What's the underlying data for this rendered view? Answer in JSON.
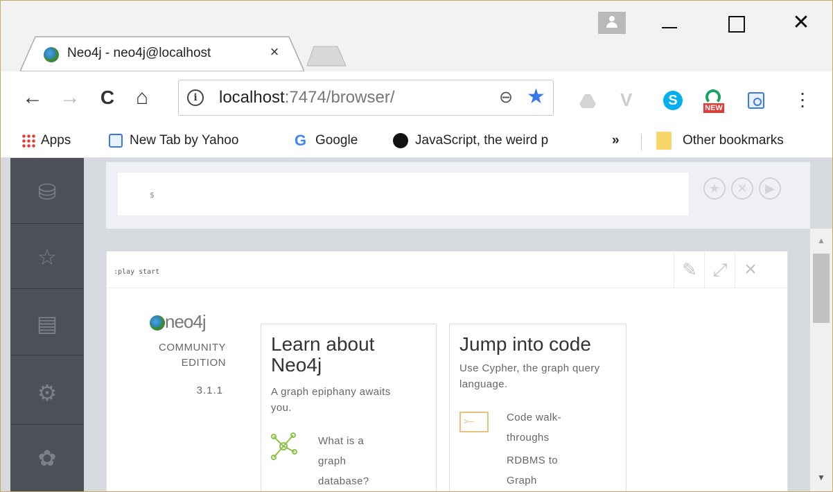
{
  "tab": {
    "title": "Neo4j - neo4j@localhost",
    "close": "×"
  },
  "window": {
    "minimize": "—",
    "maximize": "☐",
    "close": "✕"
  },
  "toolbar": {
    "back": "←",
    "forward": "→",
    "reload": "C",
    "home": "⌂",
    "url_host": "localhost",
    "url_rest": ":7474/browser/",
    "info": "i",
    "zoom": "⊖",
    "star": "★",
    "new_badge": "NEW",
    "skype": "S",
    "menu": "⋮"
  },
  "bookmarks": {
    "apps": "Apps",
    "items": [
      "New Tab by Yahoo",
      "Google",
      "JavaScript, the weird p"
    ],
    "google_glyph": "G",
    "more": "»",
    "other": "Other bookmarks"
  },
  "editor": {
    "prompt": "$"
  },
  "frame": {
    "command": ":play start"
  },
  "brand": {
    "name": "neo4j",
    "edition": "COMMUNITY EDITION",
    "version": "3.1.1"
  },
  "cards": {
    "learn": {
      "title": "Learn about Neo4j",
      "subtitle": "A graph epiphany awaits you.",
      "link": "What is a graph database?"
    },
    "code": {
      "title": "Jump into code",
      "subtitle": "Use Cypher, the graph query language.",
      "link1": "Code walk-throughs",
      "link2": "RDBMS to Graph"
    }
  },
  "colors": {
    "sidebar": "#4d4f59",
    "accent": "#3b78e7",
    "skype": "#00aff0",
    "badge": "#e53935"
  }
}
